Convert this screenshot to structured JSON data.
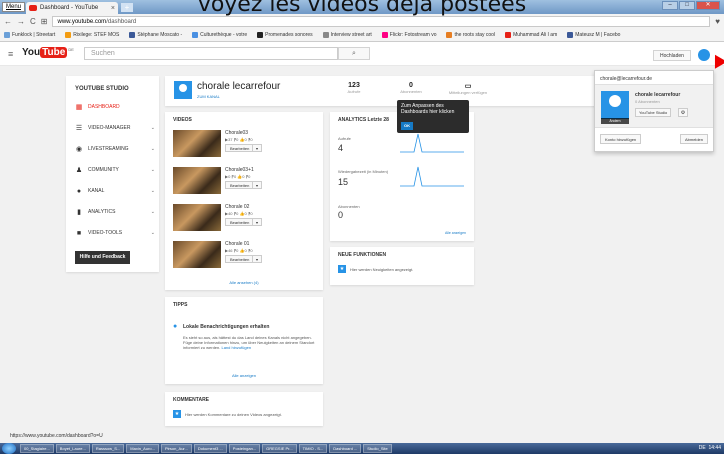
{
  "overlay": {
    "text": "voyez les vidéos déjà postées"
  },
  "browser": {
    "menu_label": "Menu",
    "tab_title": "Dashboard - YouTube",
    "tab_close": "×",
    "new_tab": "+",
    "url_domain": "www.youtube.com",
    "url_path": "/dashboard",
    "status_url": "https://www.youtube.com/dashboard?o=U",
    "bookmarks": [
      {
        "label": "Funklock | Streetart",
        "color": "#6ba0d8"
      },
      {
        "label": "Rixilege: STEF MOS",
        "color": "#f39c12"
      },
      {
        "label": "Stéphane Moscato -",
        "color": "#3b5998"
      },
      {
        "label": "Culturethèque - votre",
        "color": "#4a90e2"
      },
      {
        "label": "Promenades sonores",
        "color": "#222222"
      },
      {
        "label": "Interview street art",
        "color": "#888888"
      },
      {
        "label": "Flickr: Fotostream vo",
        "color": "#ff0084"
      },
      {
        "label": "the roots stay cool",
        "color": "#e67e22"
      },
      {
        "label": "Muhammad Ali I am",
        "color": "#e62117"
      },
      {
        "label": "Mateusz M | Facebo",
        "color": "#3b5998"
      }
    ]
  },
  "header": {
    "logo_you": "You",
    "logo_tube": "Tube",
    "logo_cc": "DE",
    "search_placeholder": "Suchen",
    "upload_label": "Hochladen"
  },
  "sidebar": {
    "title": "YOUTUBE STUDIO",
    "items": [
      {
        "label": "DASHBOARD",
        "icon": "▦"
      },
      {
        "label": "VIDEO-MANAGER",
        "icon": "☰"
      },
      {
        "label": "LIVESTREAMING",
        "icon": "◉"
      },
      {
        "label": "COMMUNITY",
        "icon": "♟"
      },
      {
        "label": "KANAL",
        "icon": "●"
      },
      {
        "label": "ANALYTICS",
        "icon": "▮"
      },
      {
        "label": "VIDEO-TOOLS",
        "icon": "■"
      }
    ],
    "chevron": "⌄",
    "feedback_label": "Hilfe und Feedback"
  },
  "channel": {
    "name": "chorale lecarrefour",
    "sub": "ZUM KANAL",
    "stat1_num": "123",
    "stat1_lbl": "Aufrufe",
    "stat2_num": "0",
    "stat2_lbl": "Abonnenten",
    "stat3_lbl": "Mitteilungen verfügen"
  },
  "videos": {
    "title": "VIDEOS",
    "items": [
      {
        "title": "Chorale03",
        "stats": "▶37  ⁋0  👍0  ⁋0"
      },
      {
        "title": "Chorale03+1",
        "stats": "▶0  ⁋0  👍0  ⁋0"
      },
      {
        "title": "Chorale 02",
        "stats": "▶40  ⁋0  👍0  ⁋0"
      },
      {
        "title": "Chorale 01",
        "stats": "▶46  ⁋0  👍0  ⁋0"
      }
    ],
    "edit_label": "Bearbeiten",
    "dd": "▾",
    "all_label": "Alle ansehen (4)"
  },
  "analytics": {
    "title": "ANALYTICS  Letzte 28",
    "m1_label": "Aufrufe",
    "m1_val": "4",
    "m2_label": "Wiedergabezeit (in Minuten)",
    "m2_val": "15",
    "m3_label": "Abonnenten",
    "m3_val": "0",
    "link": "Alle anzeigen"
  },
  "tooltip": {
    "text": "Zum Anpassen des Dashboards hier klicken",
    "ok": "OK"
  },
  "newfeat": {
    "title": "NEUE FUNKTIONEN",
    "text": "Hier werden Neuigkeiten angezeigt.",
    "icon": "★"
  },
  "tips": {
    "title": "TIPPS",
    "heading": "Lokale Benachrichtigungen erhalten",
    "body": "Es sieht so aus, als hättest du das Land deines Kanals nicht angegeben. Füge deine Informationen hinzu, um über Neuigkeiten an deinem Standort informiert zu werden.",
    "link_inline": "Land hinzufügen",
    "all": "Alle anzeigen"
  },
  "comments": {
    "title": "KOMMENTARE",
    "text": "Hier werden Kommentare zu deinen Videos angezeigt.",
    "icon": "★"
  },
  "account": {
    "email": "chorale@lecarrefour.de",
    "name": "chorale lecarrefour",
    "subs": "0 Abonnenten",
    "change": "Ändern",
    "studio": "YouTube Studio",
    "gear": "⚙",
    "add": "Konto hinzufügen",
    "logout": "Abmelden"
  },
  "taskbar": {
    "items": [
      "00_Stagiaire...",
      "Boyet_Laure...",
      "Rasssow_S...",
      "Maxin_Auro...",
      "Pirson_Aur...",
      "Dokument3 ...",
      "Posteingan...",
      "GREGSIE Pr...",
      "TIMIO - S...",
      "Dashboard ...",
      "Studio_Site"
    ],
    "lang": "DE",
    "clock": "14:44"
  },
  "colors": {
    "accent": "#e62117",
    "link": "#167ac6",
    "blue": "#2793e6"
  }
}
